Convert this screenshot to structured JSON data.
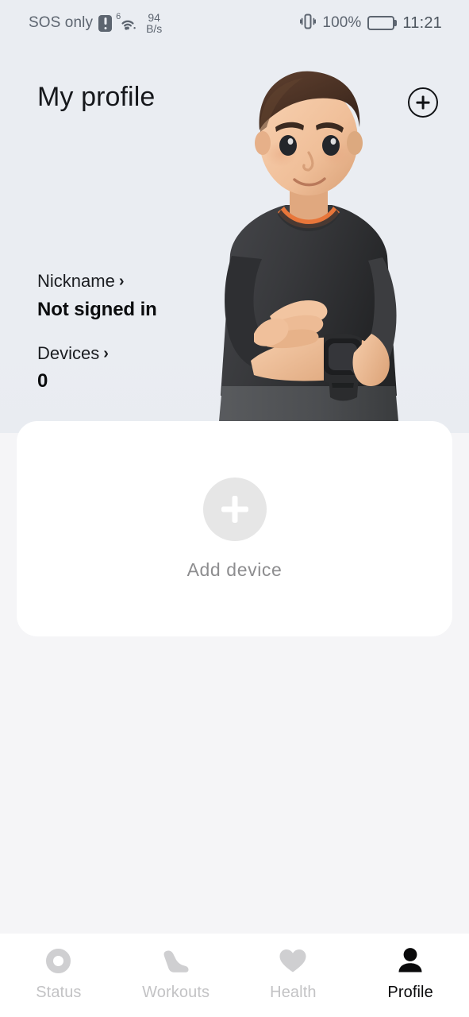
{
  "status_bar": {
    "carrier": "SOS only",
    "alert_icon": "alert-badge-icon",
    "wifi_icon": "wifi-icon",
    "wifi_generation": "6",
    "network_speed_value": "94",
    "network_speed_unit": "B/s",
    "vibrate_icon": "vibrate-icon",
    "battery_percent": "100%",
    "battery_icon": "battery-full-icon",
    "time": "11:21"
  },
  "header": {
    "title": "My profile",
    "add_button_icon": "plus-circle-icon"
  },
  "profile": {
    "nickname_label": "Nickname",
    "nickname_chevron": "›",
    "nickname_value": "Not signed in",
    "devices_label": "Devices",
    "devices_chevron": "›",
    "devices_value": "0"
  },
  "device_card": {
    "add_icon": "plus-icon",
    "add_label": "Add device"
  },
  "bottom_nav": {
    "items": [
      {
        "label": "Status",
        "icon": "activity-ring-icon",
        "active": false
      },
      {
        "label": "Workouts",
        "icon": "running-shoe-icon",
        "active": false
      },
      {
        "label": "Health",
        "icon": "heart-icon",
        "active": false
      },
      {
        "label": "Profile",
        "icon": "person-icon",
        "active": true
      }
    ]
  },
  "colors": {
    "hero_background": "#eaedf2",
    "page_background": "#f5f5f7",
    "card_background": "#ffffff",
    "text_primary": "#0b0c0e",
    "text_muted": "#8d8d8f",
    "nav_inactive": "#c3c3c5",
    "nav_active": "#0a0a0b",
    "shirt": "#3a3b3d",
    "shirt_trim": "#e8763a",
    "hair": "#4a3226",
    "skin": "#f4c4a0"
  }
}
